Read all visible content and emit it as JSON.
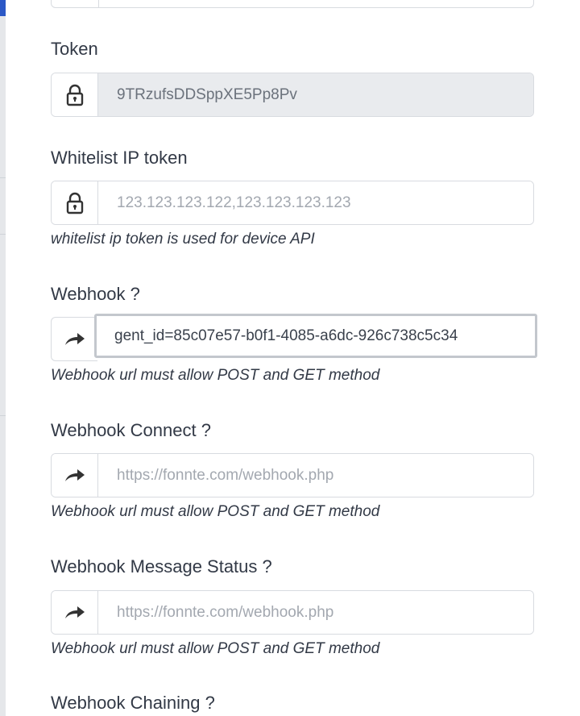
{
  "token": {
    "label": "Token",
    "value": "9TRzufsDDSppXE5Pp8Pv",
    "icon": "lock-icon"
  },
  "whitelist": {
    "label": "Whitelist IP token",
    "placeholder": "123.123.123.122,123.123.123.123",
    "help": "whitelist ip token is used for device API",
    "icon": "lock-icon"
  },
  "webhook": {
    "label": "Webhook ?",
    "value": "gent_id=85c07e57-b0f1-4085-a6dc-926c738c5c34",
    "help": "Webhook url must allow POST and GET method",
    "icon": "share-arrow-icon"
  },
  "webhook_connect": {
    "label": "Webhook Connect ?",
    "placeholder": "https://fonnte.com/webhook.php",
    "help": "Webhook url must allow POST and GET method",
    "icon": "share-arrow-icon"
  },
  "webhook_status": {
    "label": "Webhook Message Status ?",
    "placeholder": "https://fonnte.com/webhook.php",
    "help": "Webhook url must allow POST and GET method",
    "icon": "share-arrow-icon"
  },
  "webhook_chaining": {
    "label": "Webhook Chaining ?"
  }
}
